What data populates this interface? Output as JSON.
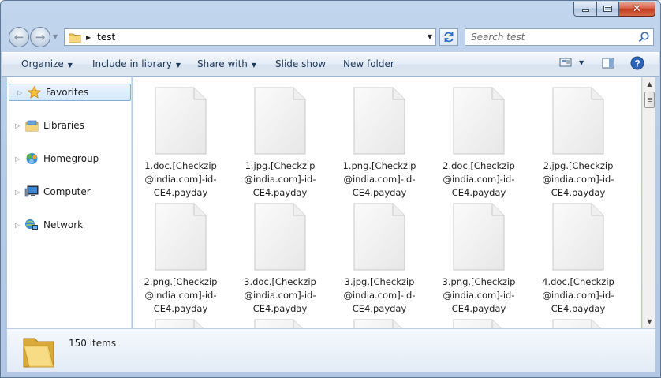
{
  "window": {
    "caption": {
      "minimize": "minimize",
      "maximize": "maximize",
      "close": "close"
    }
  },
  "address": {
    "path": "test"
  },
  "search": {
    "placeholder": "Search test"
  },
  "toolbar": {
    "organize": "Organize",
    "include_in_library": "Include in library",
    "share_with": "Share with",
    "slide_show": "Slide show",
    "new_folder": "New folder"
  },
  "sidebar": {
    "items": [
      {
        "label": "Favorites",
        "icon": "star-icon"
      },
      {
        "label": "Libraries",
        "icon": "libraries-icon"
      },
      {
        "label": "Homegroup",
        "icon": "homegroup-icon"
      },
      {
        "label": "Computer",
        "icon": "computer-icon"
      },
      {
        "label": "Network",
        "icon": "network-icon"
      }
    ]
  },
  "files": [
    {
      "name": "1.doc.[Checkzip@india.com]-id-CE4.payday"
    },
    {
      "name": "1.jpg.[Checkzip@india.com]-id-CE4.payday"
    },
    {
      "name": "1.png.[Checkzip@india.com]-id-CE4.payday"
    },
    {
      "name": "2.doc.[Checkzip@india.com]-id-CE4.payday"
    },
    {
      "name": "2.jpg.[Checkzip@india.com]-id-CE4.payday"
    },
    {
      "name": "2.png.[Checkzip@india.com]-id-CE4.payday"
    },
    {
      "name": "3.doc.[Checkzip@india.com]-id-CE4.payday"
    },
    {
      "name": "3.jpg.[Checkzip@india.com]-id-CE4.payday"
    },
    {
      "name": "3.png.[Checkzip@india.com]-id-CE4.payday"
    },
    {
      "name": "4.doc.[Checkzip@india.com]-id-CE4.payday"
    }
  ],
  "status": {
    "item_count": "150 items"
  },
  "colors": {
    "toolbar_text": "#1e395b",
    "selection_border": "#84acdd",
    "frame": "#b6cbe6"
  }
}
